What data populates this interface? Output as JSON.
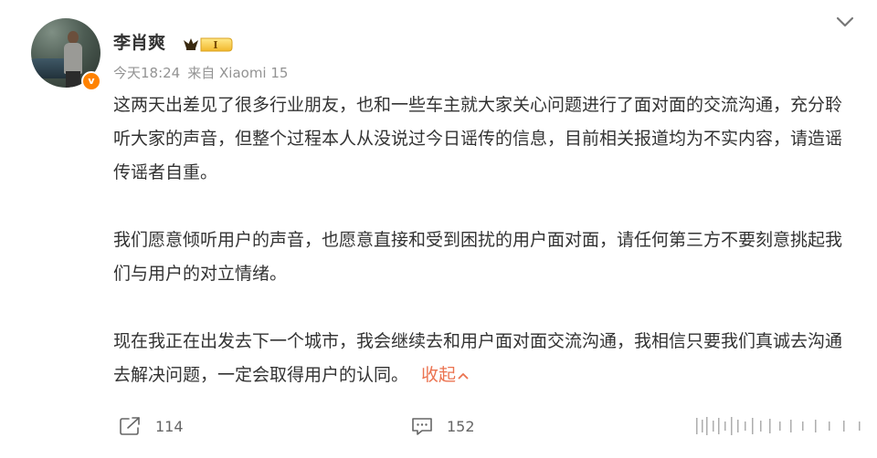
{
  "post": {
    "author": {
      "name": "李肖爽",
      "level": "I",
      "verified_mark": "v"
    },
    "meta": {
      "time": "今天18:24",
      "source": "来自 Xiaomi 15"
    },
    "paragraphs": [
      "这两天出差见了很多行业朋友，也和一些车主就大家关心问题进行了面对面的交流沟通，充分聆听大家的声音，但整个过程本人从没说过今日谣传的信息，目前相关报道均为不实内容，请造谣传谣者自重。",
      "我们愿意倾听用户的声音，也愿意直接和受到困扰的用户面对面，请任何第三方不要刻意挑起我们与用户的对立情绪。",
      "现在我正在出发去下一个城市，我会继续去和用户面对面交流沟通，我相信只要我们真诚去沟通去解决问题，一定会取得用户的认同。"
    ],
    "collapse_label": "收起",
    "actions": {
      "repost_count": "114",
      "comment_count": "152"
    }
  },
  "colors": {
    "link": "#eb7350",
    "badge": "#ff8200",
    "meta_text": "#939393",
    "body_text": "#333333"
  },
  "icons": [
    "avatar-image",
    "verified-icon",
    "level-badge-icon",
    "chevron-down-icon",
    "chevron-up-icon",
    "repost-icon",
    "comment-icon",
    "like-icon"
  ]
}
